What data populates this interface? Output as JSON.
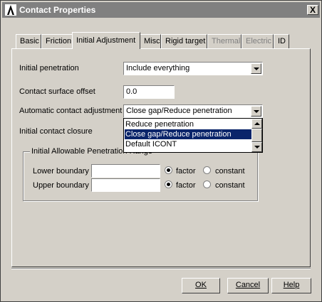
{
  "window": {
    "title": "Contact Properties",
    "close_glyph": "X"
  },
  "tabs": [
    {
      "label": "Basic",
      "state": "normal"
    },
    {
      "label": "Friction",
      "state": "normal"
    },
    {
      "label": "Initial Adjustment",
      "state": "active"
    },
    {
      "label": "Misc",
      "state": "normal"
    },
    {
      "label": "Rigid target",
      "state": "normal"
    },
    {
      "label": "Thermal",
      "state": "disabled"
    },
    {
      "label": "Electric",
      "state": "disabled"
    },
    {
      "label": "ID",
      "state": "normal"
    }
  ],
  "form": {
    "initial_penetration": {
      "label": "Initial penetration",
      "value": "Include everything"
    },
    "contact_surface_offset": {
      "label": "Contact surface offset",
      "value": "0.0"
    },
    "automatic_contact_adjustment": {
      "label": "Automatic contact adjustment",
      "value": "Close gap/Reduce penetration",
      "options": [
        "Reduce penetration",
        "Close gap/Reduce penetration",
        "Default ICONT"
      ],
      "selected_option": "Close gap/Reduce penetration"
    },
    "initial_contact_closure": {
      "label": "Initial contact closure"
    }
  },
  "penetration_range": {
    "title": "Initial Allowable Penetration Range",
    "lower": {
      "label": "Lower boundary",
      "value": "",
      "factor_label": "factor",
      "constant_label": "constant",
      "selected": "factor"
    },
    "upper": {
      "label": "Upper boundary",
      "value": "",
      "factor_label": "factor",
      "constant_label": "constant",
      "selected": "factor"
    }
  },
  "buttons": {
    "ok": "OK",
    "cancel": "Cancel",
    "help": "Help"
  }
}
